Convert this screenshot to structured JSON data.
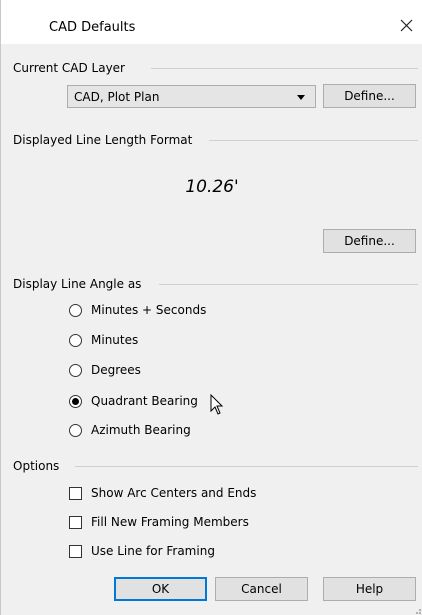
{
  "window": {
    "title": "CAD Defaults",
    "close_glyph": "×"
  },
  "current_layer": {
    "group_label": "Current CAD Layer",
    "selected_value": "CAD, Plot Plan",
    "define_label": "Define..."
  },
  "line_length": {
    "group_label": "Displayed Line Length Format",
    "sample_value": "10.26'",
    "define_label": "Define..."
  },
  "line_angle": {
    "group_label": "Display Line Angle as",
    "options": [
      {
        "label": "Minutes + Seconds",
        "selected": false
      },
      {
        "label": "Minutes",
        "selected": false
      },
      {
        "label": "Degrees",
        "selected": false
      },
      {
        "label": "Quadrant Bearing",
        "selected": true
      },
      {
        "label": "Azimuth Bearing",
        "selected": false
      }
    ]
  },
  "options": {
    "group_label": "Options",
    "checkboxes": [
      {
        "label": "Show Arc Centers and Ends",
        "checked": false
      },
      {
        "label": "Fill New Framing Members",
        "checked": false
      },
      {
        "label": "Use Line for Framing",
        "checked": false
      }
    ]
  },
  "buttons": {
    "ok": "OK",
    "cancel": "Cancel",
    "help": "Help"
  },
  "colors": {
    "accent": "#0078d7",
    "dialog_bg": "#f0f0f0",
    "button_bg": "#e1e1e1"
  },
  "icons": {
    "close": "close-icon",
    "dropdown": "chevron-down-icon",
    "cursor": "mouse-pointer-icon"
  }
}
